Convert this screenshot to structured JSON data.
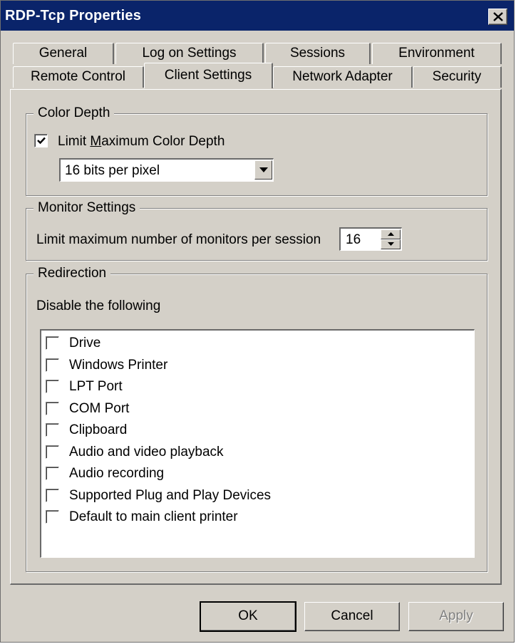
{
  "window": {
    "title": "RDP-Tcp Properties",
    "close_icon": "close-icon"
  },
  "tabs": {
    "row_back": [
      {
        "label": "General"
      },
      {
        "label": "Log on Settings"
      },
      {
        "label": "Sessions"
      },
      {
        "label": "Environment"
      }
    ],
    "row_front": [
      {
        "label": "Remote Control"
      },
      {
        "label": "Client Settings",
        "active": true
      },
      {
        "label": "Network Adapter"
      },
      {
        "label": "Security"
      }
    ]
  },
  "color_depth": {
    "legend": "Color Depth",
    "limit_label_pre": "Limit ",
    "limit_label_accel": "M",
    "limit_label_post": "aximum Color Depth",
    "limit_checked": true,
    "depth_value": "16 bits per pixel"
  },
  "monitor_settings": {
    "legend": "Monitor Settings",
    "label": "Limit maximum number of monitors per session",
    "value": "16"
  },
  "redirection": {
    "legend": "Redirection",
    "instruction": "Disable the following",
    "items": [
      {
        "label": "Drive",
        "checked": false
      },
      {
        "label": "Windows Printer",
        "checked": false
      },
      {
        "label": "LPT Port",
        "checked": false
      },
      {
        "label": "COM Port",
        "checked": false
      },
      {
        "label": "Clipboard",
        "checked": false
      },
      {
        "label": "Audio and video playback",
        "checked": false
      },
      {
        "label": "Audio recording",
        "checked": false
      },
      {
        "label": "Supported Plug and Play Devices",
        "checked": false
      },
      {
        "label": "Default to main client printer",
        "checked": false
      }
    ]
  },
  "buttons": {
    "ok": "OK",
    "cancel": "Cancel",
    "apply": "Apply"
  },
  "colors": {
    "titlebar": "#0a246a",
    "face": "#d4d0c8"
  }
}
